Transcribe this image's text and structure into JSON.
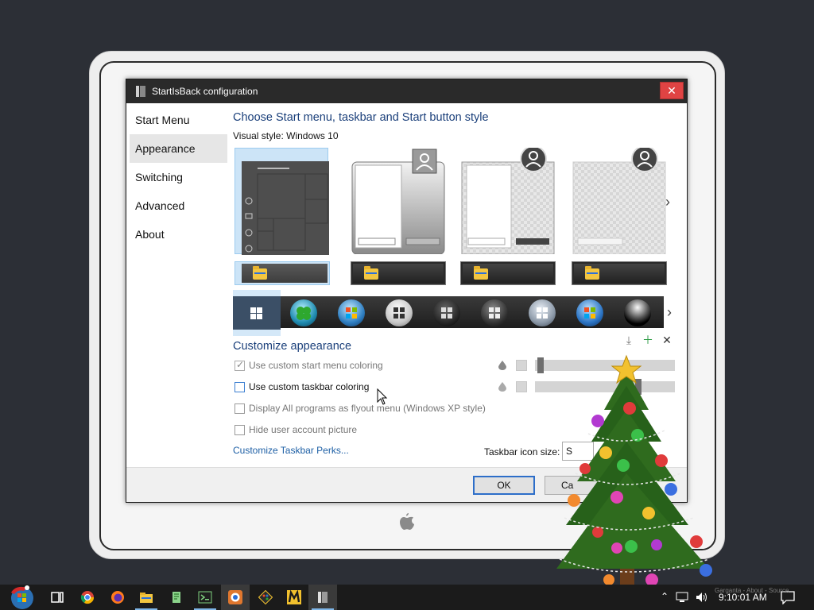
{
  "window": {
    "title": "StartIsBack configuration",
    "close_symbol": "✕"
  },
  "sidebar": {
    "items": [
      {
        "label": "Start Menu",
        "active": false
      },
      {
        "label": "Appearance",
        "active": true
      },
      {
        "label": "Switching",
        "active": false
      },
      {
        "label": "Advanced",
        "active": false
      },
      {
        "label": "About",
        "active": false
      }
    ]
  },
  "main": {
    "heading": "Choose Start menu, taskbar and Start button style",
    "visual_style_label": "Visual style:  Windows 10",
    "next_symbol": "›",
    "customize_heading": "Customize appearance",
    "checkboxes": [
      {
        "label": "Use custom start menu coloring",
        "checked": true,
        "enabled": false
      },
      {
        "label": "Use custom taskbar coloring",
        "checked": false,
        "enabled": true
      },
      {
        "label": "Display All programs as flyout menu (Windows XP style)",
        "checked": false,
        "enabled": false
      },
      {
        "label": "Hide user account picture",
        "checked": false,
        "enabled": false
      }
    ],
    "sliders": [
      {
        "level": 0.02
      },
      {
        "level": 0.75
      }
    ],
    "perks_link": "Customize Taskbar Perks...",
    "taskbar_icon_size_label": "Taskbar icon size:",
    "taskbar_icon_size_value": "S",
    "tool_icons": [
      "download-icon",
      "plus-icon",
      "close-icon"
    ]
  },
  "footer": {
    "ok_label": "OK",
    "cancel_label": "Ca"
  },
  "taskbar": {
    "clock": "9:10:01 AM",
    "credit": "Garganta - About - Source",
    "apps": [
      "start-orb",
      "task-view",
      "chrome",
      "firefox",
      "file-explorer",
      "notepad-plus",
      "console",
      "obs",
      "git",
      "m-app",
      "startisback"
    ]
  },
  "colors": {
    "accent": "#1a3f7a",
    "link": "#1d5fa5",
    "selection": "#cce4f7",
    "close_red": "#e04343"
  }
}
